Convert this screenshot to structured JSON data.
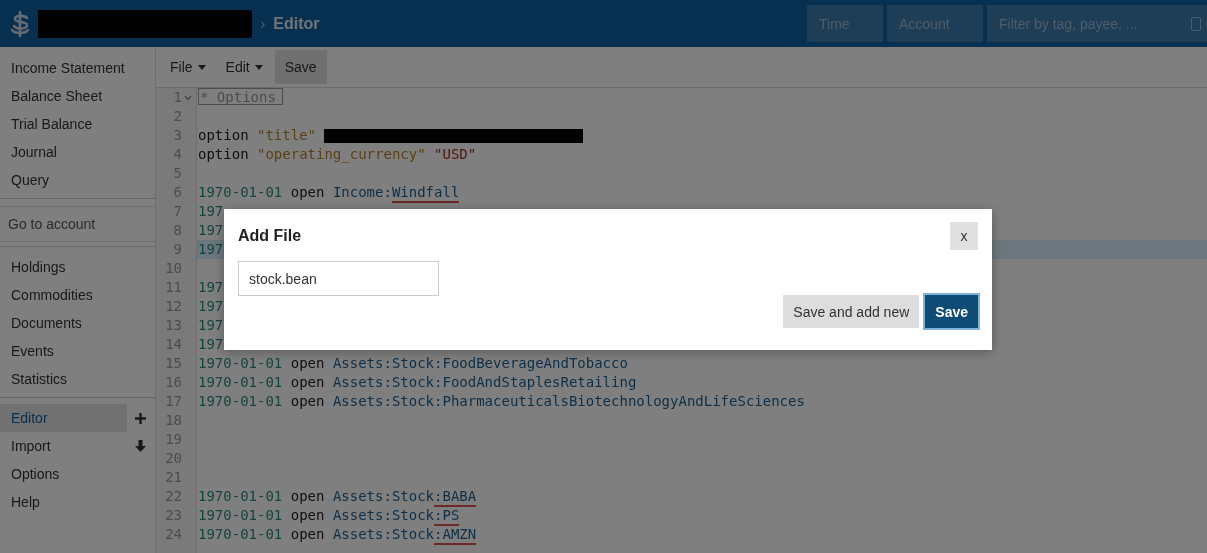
{
  "header": {
    "breadcrumb_separator": "›",
    "page_title": "Editor",
    "time_filter": {
      "placeholder": "Time"
    },
    "account_filter": {
      "placeholder": "Account"
    },
    "tag_filter": {
      "placeholder": "Filter by tag, payee, ..."
    }
  },
  "sidebar": {
    "sections": [
      {
        "items": [
          {
            "label": "Income Statement",
            "selected": false,
            "kind": "plain"
          },
          {
            "label": "Balance Sheet",
            "selected": false,
            "kind": "plain"
          },
          {
            "label": "Trial Balance",
            "selected": false,
            "kind": "plain"
          },
          {
            "label": "Journal",
            "selected": false,
            "kind": "plain"
          },
          {
            "label": "Query",
            "selected": false,
            "kind": "plain"
          }
        ]
      },
      {
        "account_search": {
          "placeholder": "Go to account"
        }
      },
      {
        "items": [
          {
            "label": "Holdings",
            "selected": false,
            "kind": "plain"
          },
          {
            "label": "Commodities",
            "selected": false,
            "kind": "plain"
          },
          {
            "label": "Documents",
            "selected": false,
            "kind": "plain"
          },
          {
            "label": "Events",
            "selected": false,
            "kind": "plain"
          },
          {
            "label": "Statistics",
            "selected": false,
            "kind": "plain"
          }
        ]
      },
      {
        "items": [
          {
            "label": "Editor",
            "selected": true,
            "kind": "add"
          },
          {
            "label": "Import",
            "selected": false,
            "kind": "download"
          },
          {
            "label": "Options",
            "selected": false,
            "kind": "plain"
          },
          {
            "label": "Help",
            "selected": false,
            "kind": "plain"
          }
        ]
      }
    ]
  },
  "toolbar": [
    {
      "label": "File",
      "kind": "menu"
    },
    {
      "label": "Edit",
      "kind": "menu"
    },
    {
      "label": "Save",
      "kind": "button"
    }
  ],
  "editor": {
    "lines": [
      {
        "number": "1",
        "active": false,
        "foldable": true,
        "tokens": [
          {
            "kind": "heading",
            "text": "* Options",
            "flagged": false
          }
        ]
      },
      {
        "number": "2",
        "active": false,
        "foldable": false
      },
      {
        "number": "3",
        "active": false,
        "foldable": false,
        "tokens": [
          {
            "kind": "keyword",
            "text": "option ",
            "flagged": false
          },
          {
            "kind": "string",
            "text": "\"title\" ",
            "flagged": false
          },
          {
            "kind": "redacted",
            "flagged": false
          }
        ]
      },
      {
        "number": "4",
        "active": false,
        "foldable": false,
        "tokens": [
          {
            "kind": "keyword",
            "text": "option ",
            "flagged": false
          },
          {
            "kind": "string",
            "text": "\"operating_currency\" ",
            "flagged": false
          },
          {
            "kind": "currency",
            "text": "\"USD\"",
            "flagged": false
          }
        ]
      },
      {
        "number": "5",
        "active": false,
        "foldable": false
      },
      {
        "number": "6",
        "active": false,
        "foldable": false,
        "tokens": [
          {
            "kind": "date",
            "text": "1970-01-01",
            "flagged": false
          },
          {
            "kind": "keyword",
            "text": " open ",
            "flagged": false
          },
          {
            "kind": "account",
            "text": "Income:",
            "flagged": false
          },
          {
            "kind": "account",
            "text": "Windfall",
            "flagged": true
          }
        ]
      },
      {
        "number": "7",
        "active": false,
        "foldable": false,
        "tokens": [
          {
            "kind": "date",
            "text": "197",
            "flagged": false
          }
        ]
      },
      {
        "number": "8",
        "active": false,
        "foldable": false,
        "tokens": [
          {
            "kind": "date",
            "text": "197",
            "flagged": false
          }
        ]
      },
      {
        "number": "9",
        "active": true,
        "foldable": false,
        "tokens": [
          {
            "kind": "date",
            "text": "197",
            "flagged": false
          }
        ]
      },
      {
        "number": "10",
        "active": false,
        "foldable": false
      },
      {
        "number": "11",
        "active": false,
        "foldable": false,
        "tokens": [
          {
            "kind": "date",
            "text": "197",
            "flagged": false
          }
        ]
      },
      {
        "number": "12",
        "active": false,
        "foldable": false,
        "tokens": [
          {
            "kind": "date",
            "text": "197",
            "flagged": false
          }
        ]
      },
      {
        "number": "13",
        "active": false,
        "foldable": false,
        "tokens": [
          {
            "kind": "date",
            "text": "197",
            "flagged": false
          }
        ]
      },
      {
        "number": "14",
        "active": false,
        "foldable": false,
        "tokens": [
          {
            "kind": "date",
            "text": "197",
            "flagged": false
          }
        ]
      },
      {
        "number": "15",
        "active": false,
        "foldable": false,
        "tokens": [
          {
            "kind": "date",
            "text": "1970-01-01",
            "flagged": false
          },
          {
            "kind": "keyword",
            "text": " open ",
            "flagged": false
          },
          {
            "kind": "account",
            "text": "Assets:Stock:FoodBeverageAndTobacco",
            "flagged": false
          }
        ]
      },
      {
        "number": "16",
        "active": false,
        "foldable": false,
        "tokens": [
          {
            "kind": "date",
            "text": "1970-01-01",
            "flagged": false
          },
          {
            "kind": "keyword",
            "text": " open ",
            "flagged": false
          },
          {
            "kind": "account",
            "text": "Assets:Stock:FoodAndStaplesRetailing",
            "flagged": false
          }
        ]
      },
      {
        "number": "17",
        "active": false,
        "foldable": false,
        "tokens": [
          {
            "kind": "date",
            "text": "1970-01-01",
            "flagged": false
          },
          {
            "kind": "keyword",
            "text": " open ",
            "flagged": false
          },
          {
            "kind": "account",
            "text": "Assets:Stock:PharmaceuticalsBiotechnologyAndLifeSciences",
            "flagged": false
          }
        ]
      },
      {
        "number": "18",
        "active": false,
        "foldable": false
      },
      {
        "number": "19",
        "active": false,
        "foldable": false
      },
      {
        "number": "20",
        "active": false,
        "foldable": false
      },
      {
        "number": "21",
        "active": false,
        "foldable": false
      },
      {
        "number": "22",
        "active": false,
        "foldable": false,
        "tokens": [
          {
            "kind": "date",
            "text": "1970-01-01",
            "flagged": false
          },
          {
            "kind": "keyword",
            "text": " open ",
            "flagged": false
          },
          {
            "kind": "account",
            "text": "Assets:Stock",
            "flagged": false
          },
          {
            "kind": "account",
            "text": ":BABA",
            "flagged": true
          }
        ]
      },
      {
        "number": "23",
        "active": false,
        "foldable": false,
        "tokens": [
          {
            "kind": "date",
            "text": "1970-01-01",
            "flagged": false
          },
          {
            "kind": "keyword",
            "text": " open ",
            "flagged": false
          },
          {
            "kind": "account",
            "text": "Assets:Stock",
            "flagged": false
          },
          {
            "kind": "account",
            "text": ":PS",
            "flagged": true
          }
        ]
      },
      {
        "number": "24",
        "active": false,
        "foldable": false,
        "tokens": [
          {
            "kind": "date",
            "text": "1970-01-01",
            "flagged": false
          },
          {
            "kind": "keyword",
            "text": " open ",
            "flagged": false
          },
          {
            "kind": "account",
            "text": "Assets:Stock",
            "flagged": false
          },
          {
            "kind": "account",
            "text": ":AMZN",
            "flagged": true
          }
        ]
      }
    ]
  },
  "dialog": {
    "title": "Add File",
    "close": "x",
    "filename": {
      "value": "stock.bean"
    },
    "buttons": [
      {
        "label": "Save and add new",
        "kind": "secondary"
      },
      {
        "label": "Save",
        "kind": "primary"
      }
    ]
  }
}
